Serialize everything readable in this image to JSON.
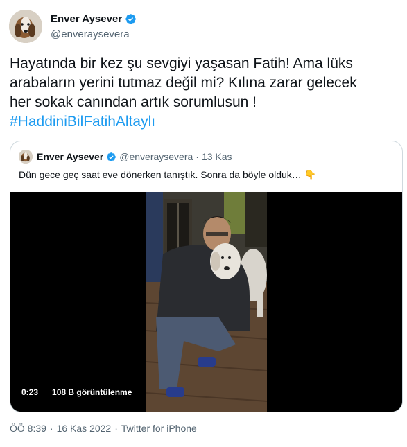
{
  "author": {
    "name": "Enver Aysever",
    "handle": "@enveraysevera",
    "verified": true
  },
  "tweet": {
    "lines": [
      "Hayatında bir kez şu sevgiyi yaşasan Fatih! Ama lüks",
      "arabaların yerini tutmaz değil mi? Kılına zarar gelecek",
      "her sokak canından artık sorumlusun !"
    ],
    "hashtag": "#HaddiniBilFatihAltaylı"
  },
  "quoted": {
    "name": "Enver Aysever",
    "handle": "@enveraysevera",
    "dot": "·",
    "date": "13 Kas",
    "text": "Dün gece geç saat eve dönerken tanıştık. Sonra da böyle olduk…",
    "emoji": "👇",
    "video": {
      "duration": "0:23",
      "views": "108 B görüntülenme"
    }
  },
  "footer": {
    "time": "ÖÖ 8:39",
    "sep1": "·",
    "date": "16 Kas 2022",
    "sep2": "·",
    "source": "Twitter for iPhone"
  },
  "colors": {
    "accent": "#1d9bf0",
    "text": "#0f1419",
    "muted": "#536471",
    "border": "#cfd9de"
  },
  "icons": {
    "verified": "verified-badge-icon"
  }
}
